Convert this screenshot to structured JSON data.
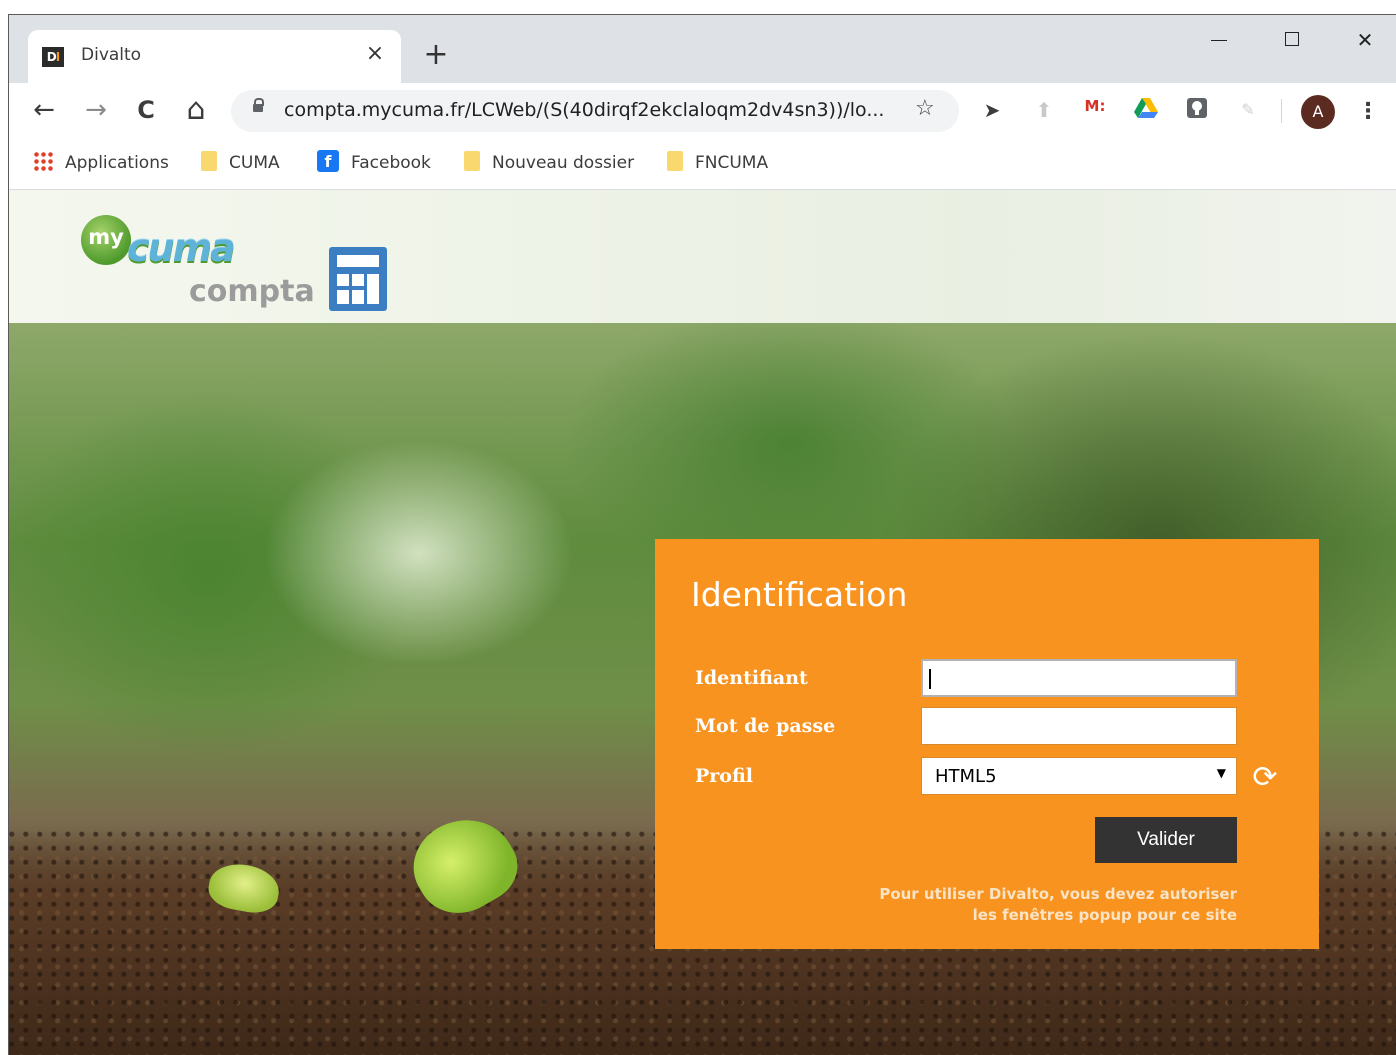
{
  "browser": {
    "tab": {
      "favicon": "DI",
      "title": "Divalto",
      "close": "×"
    },
    "new_tab": "+",
    "window": {
      "minimize": "",
      "maximize": "",
      "close": "✕"
    },
    "toolbar": {
      "back": "←",
      "forward": "→",
      "reload": "C",
      "home": "⌂",
      "url": "compta.mycuma.fr/LCWeb/(S(40dirqf2ekclaloqm2dv4sn3))/lo...",
      "star": "☆",
      "extensions": [
        {
          "name": "send-icon",
          "glyph": "➤"
        },
        {
          "name": "pin-icon",
          "glyph": "⬆"
        },
        {
          "name": "gmail-icon",
          "glyph": "M:"
        },
        {
          "name": "drive-icon",
          "glyph": "▲"
        },
        {
          "name": "lastpass-icon",
          "glyph": "⚿"
        },
        {
          "name": "pen-icon",
          "glyph": "✎"
        }
      ],
      "avatar": "A",
      "menu": "⋮"
    },
    "bookmarks": [
      {
        "label": "Applications",
        "icon": "apps-icon"
      },
      {
        "label": "CUMA",
        "icon": "folder-icon"
      },
      {
        "label": "Facebook",
        "icon": "facebook-icon"
      },
      {
        "label": "Nouveau dossier",
        "icon": "folder-icon"
      },
      {
        "label": "FNCUMA",
        "icon": "folder-icon"
      }
    ]
  },
  "logo": {
    "my": "my",
    "cuma": "cuma",
    "compta": "compta"
  },
  "login": {
    "title": "Identification",
    "username_label": "Identifiant",
    "username_value": "",
    "password_label": "Mot de passe",
    "password_value": "",
    "profile_label": "Profil",
    "profile_value": "HTML5",
    "profile_arrow": "▼",
    "refresh": "⟳",
    "submit_label": "Valider",
    "notice_line1": "Pour utiliser Divalto, vous devez autoriser",
    "notice_line2": "les fenêtres popup pour ce site"
  },
  "colors": {
    "login_panel": "#f7931e",
    "button": "#333333",
    "brand_green": "#4f9a2c",
    "brand_blue": "#3b7fc2"
  }
}
